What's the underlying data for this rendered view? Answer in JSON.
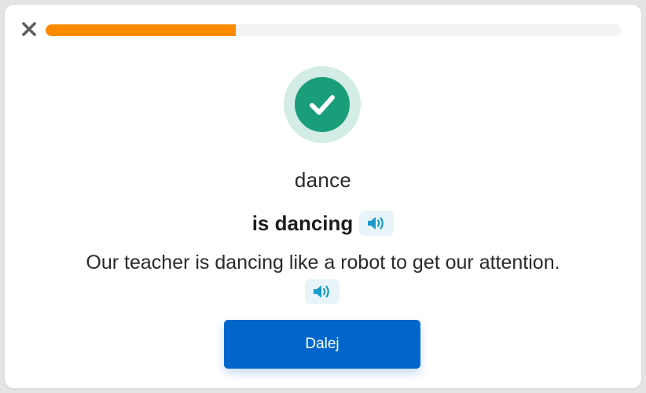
{
  "header": {
    "close_icon": "close-icon",
    "progress": {
      "fraction": 0.33,
      "color": "#fb8a00"
    }
  },
  "result": {
    "icon": "check-circle-icon",
    "color": "#1a9e7a"
  },
  "flashcard": {
    "word": "dance",
    "form": "is dancing",
    "form_audio_icon": "speaker-icon",
    "sentence": "Our teacher is dancing like a robot to get our attention.",
    "sentence_audio_icon": "speaker-icon",
    "audio_color": "#1a9bc9"
  },
  "footer": {
    "next_label": "Dalej",
    "button_color": "#0066cc"
  }
}
